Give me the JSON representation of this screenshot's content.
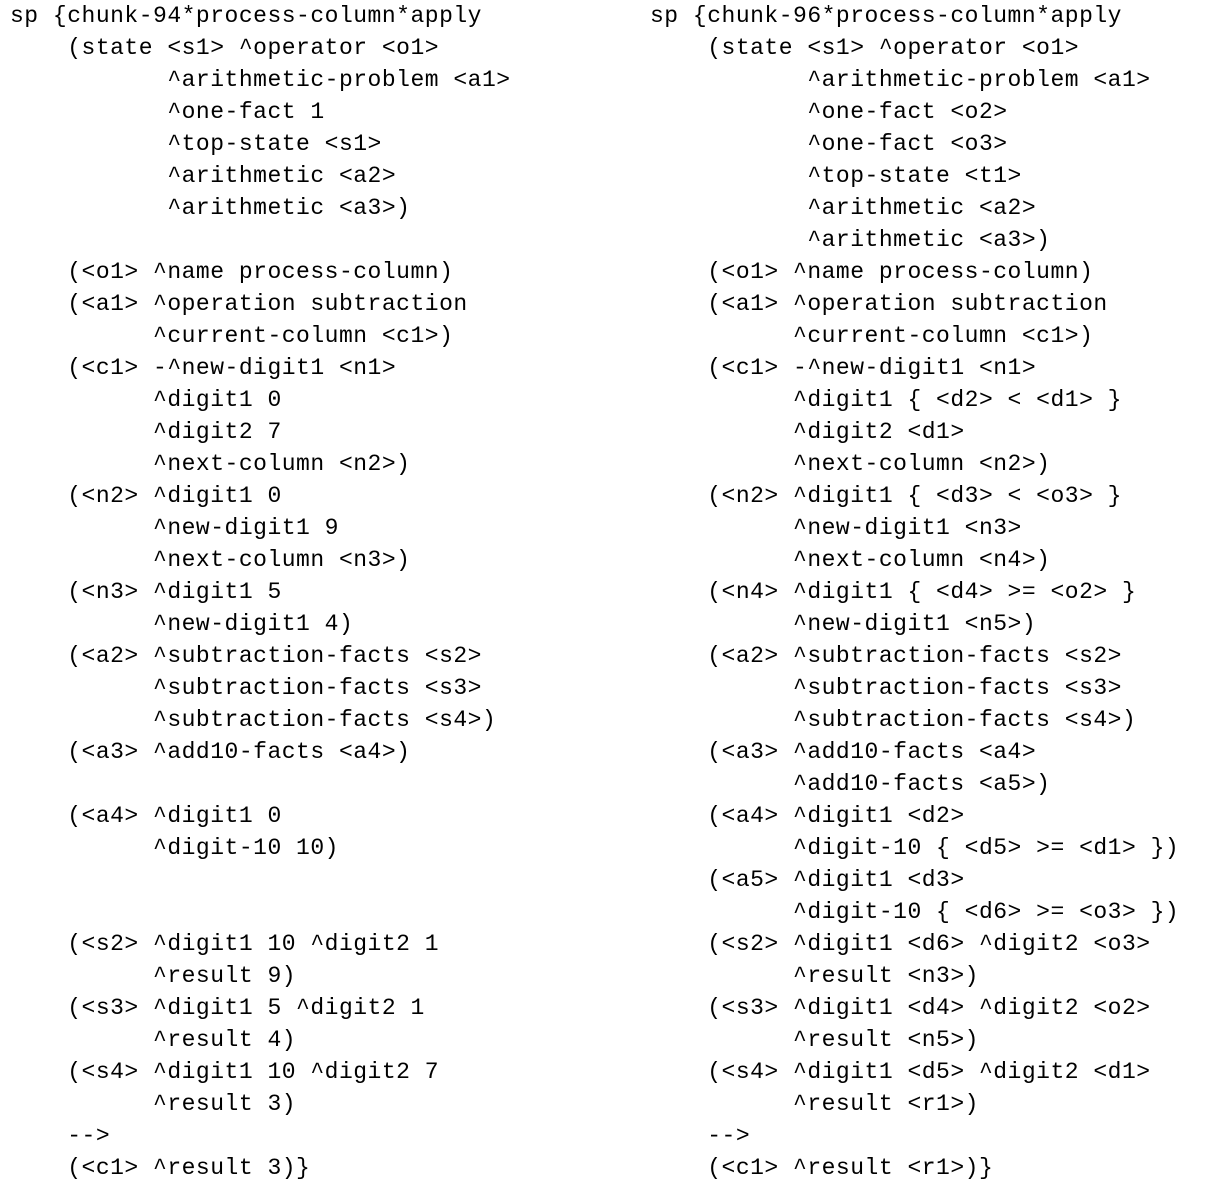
{
  "left_rule": {
    "lines": [
      "sp {chunk-94*process-column*apply",
      "    (state <s1> ^operator <o1>",
      "           ^arithmetic-problem <a1>",
      "           ^one-fact 1",
      "           ^top-state <s1>",
      "           ^arithmetic <a2>",
      "           ^arithmetic <a3>)",
      "",
      "    (<o1> ^name process-column)",
      "    (<a1> ^operation subtraction",
      "          ^current-column <c1>)",
      "    (<c1> -^new-digit1 <n1>",
      "          ^digit1 0",
      "          ^digit2 7",
      "          ^next-column <n2>)",
      "    (<n2> ^digit1 0",
      "          ^new-digit1 9",
      "          ^next-column <n3>)",
      "    (<n3> ^digit1 5",
      "          ^new-digit1 4)",
      "    (<a2> ^subtraction-facts <s2>",
      "          ^subtraction-facts <s3>",
      "          ^subtraction-facts <s4>)",
      "    (<a3> ^add10-facts <a4>)",
      "",
      "    (<a4> ^digit1 0",
      "          ^digit-10 10)",
      "",
      "",
      "    (<s2> ^digit1 10 ^digit2 1",
      "          ^result 9)",
      "    (<s3> ^digit1 5 ^digit2 1",
      "          ^result 4)",
      "    (<s4> ^digit1 10 ^digit2 7",
      "          ^result 3)",
      "    -->",
      "    (<c1> ^result 3)}"
    ]
  },
  "right_rule": {
    "lines": [
      "sp {chunk-96*process-column*apply",
      "    (state <s1> ^operator <o1>",
      "           ^arithmetic-problem <a1>",
      "           ^one-fact <o2>",
      "           ^one-fact <o3>",
      "           ^top-state <t1>",
      "           ^arithmetic <a2>",
      "           ^arithmetic <a3>)",
      "    (<o1> ^name process-column)",
      "    (<a1> ^operation subtraction",
      "          ^current-column <c1>)",
      "    (<c1> -^new-digit1 <n1>",
      "          ^digit1 { <d2> < <d1> }",
      "          ^digit2 <d1>",
      "          ^next-column <n2>)",
      "    (<n2> ^digit1 { <d3> < <o3> }",
      "          ^new-digit1 <n3>",
      "          ^next-column <n4>)",
      "    (<n4> ^digit1 { <d4> >= <o2> }",
      "          ^new-digit1 <n5>)",
      "    (<a2> ^subtraction-facts <s2>",
      "          ^subtraction-facts <s3>",
      "          ^subtraction-facts <s4>)",
      "    (<a3> ^add10-facts <a4>",
      "          ^add10-facts <a5>)",
      "    (<a4> ^digit1 <d2>",
      "          ^digit-10 { <d5> >= <d1> })",
      "    (<a5> ^digit1 <d3>",
      "          ^digit-10 { <d6> >= <o3> })",
      "    (<s2> ^digit1 <d6> ^digit2 <o3>",
      "          ^result <n3>)",
      "    (<s3> ^digit1 <d4> ^digit2 <o2>",
      "          ^result <n5>)",
      "    (<s4> ^digit1 <d5> ^digit2 <d1>",
      "          ^result <r1>)",
      "    -->",
      "    (<c1> ^result <r1>)}"
    ]
  }
}
